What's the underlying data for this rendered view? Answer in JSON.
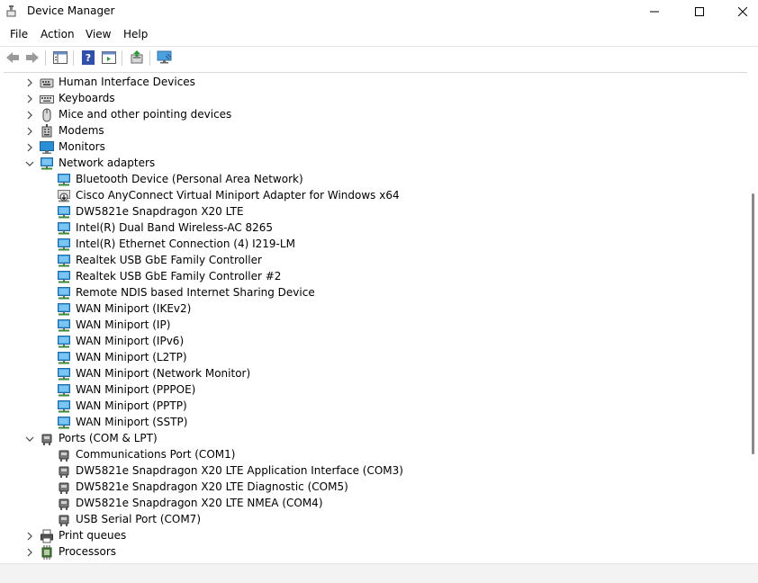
{
  "window": {
    "title": "Device Manager"
  },
  "menu": {
    "items": [
      "File",
      "Action",
      "View",
      "Help"
    ]
  },
  "toolbar": {
    "buttons": [
      "back-icon",
      "forward-icon",
      "show-hide-console-tree-icon",
      "help-icon",
      "properties-icon",
      "update-driver-icon",
      "scan-hardware-icon"
    ]
  },
  "tree": {
    "rows": [
      {
        "label": "Human Interface Devices",
        "level": 0,
        "expanded": false,
        "icon": "hid-icon"
      },
      {
        "label": "Keyboards",
        "level": 0,
        "expanded": false,
        "icon": "keyboard-icon"
      },
      {
        "label": "Mice and other pointing devices",
        "level": 0,
        "expanded": false,
        "icon": "mouse-icon"
      },
      {
        "label": "Modems",
        "level": 0,
        "expanded": false,
        "icon": "modem-icon"
      },
      {
        "label": "Monitors",
        "level": 0,
        "expanded": false,
        "icon": "monitor-icon"
      },
      {
        "label": "Network adapters",
        "level": 0,
        "expanded": true,
        "icon": "network-adapter-icon"
      },
      {
        "label": "Bluetooth Device (Personal Area Network)",
        "level": 1,
        "icon": "network-adapter-icon"
      },
      {
        "label": "Cisco AnyConnect Virtual Miniport Adapter for Windows x64",
        "level": 1,
        "icon": "network-adapter-disabled-icon"
      },
      {
        "label": "DW5821e Snapdragon X20 LTE",
        "level": 1,
        "icon": "network-adapter-icon"
      },
      {
        "label": "Intel(R) Dual Band Wireless-AC 8265",
        "level": 1,
        "icon": "network-adapter-icon"
      },
      {
        "label": "Intel(R) Ethernet Connection (4) I219-LM",
        "level": 1,
        "icon": "network-adapter-icon"
      },
      {
        "label": "Realtek USB GbE Family Controller",
        "level": 1,
        "icon": "network-adapter-icon"
      },
      {
        "label": "Realtek USB GbE Family Controller #2",
        "level": 1,
        "icon": "network-adapter-icon"
      },
      {
        "label": "Remote NDIS based Internet Sharing Device",
        "level": 1,
        "icon": "network-adapter-icon"
      },
      {
        "label": "WAN Miniport (IKEv2)",
        "level": 1,
        "icon": "network-adapter-icon"
      },
      {
        "label": "WAN Miniport (IP)",
        "level": 1,
        "icon": "network-adapter-icon"
      },
      {
        "label": "WAN Miniport (IPv6)",
        "level": 1,
        "icon": "network-adapter-icon"
      },
      {
        "label": "WAN Miniport (L2TP)",
        "level": 1,
        "icon": "network-adapter-icon"
      },
      {
        "label": "WAN Miniport (Network Monitor)",
        "level": 1,
        "icon": "network-adapter-icon"
      },
      {
        "label": "WAN Miniport (PPPOE)",
        "level": 1,
        "icon": "network-adapter-icon"
      },
      {
        "label": "WAN Miniport (PPTP)",
        "level": 1,
        "icon": "network-adapter-icon"
      },
      {
        "label": "WAN Miniport (SSTP)",
        "level": 1,
        "icon": "network-adapter-icon"
      },
      {
        "label": "Ports (COM & LPT)",
        "level": 0,
        "expanded": true,
        "icon": "port-icon"
      },
      {
        "label": "Communications Port (COM1)",
        "level": 1,
        "icon": "port-icon"
      },
      {
        "label": "DW5821e Snapdragon X20 LTE Application Interface (COM3)",
        "level": 1,
        "icon": "port-icon"
      },
      {
        "label": "DW5821e Snapdragon X20 LTE Diagnostic (COM5)",
        "level": 1,
        "icon": "port-icon"
      },
      {
        "label": "DW5821e Snapdragon X20 LTE NMEA (COM4)",
        "level": 1,
        "icon": "port-icon"
      },
      {
        "label": "USB Serial Port (COM7)",
        "level": 1,
        "icon": "port-icon"
      },
      {
        "label": "Print queues",
        "level": 0,
        "expanded": false,
        "icon": "printer-icon"
      },
      {
        "label": "Processors",
        "level": 0,
        "expanded": false,
        "icon": "processor-icon"
      }
    ]
  },
  "colors": {
    "accent_blue": "#2b8fd6",
    "chevron": "#444444"
  }
}
